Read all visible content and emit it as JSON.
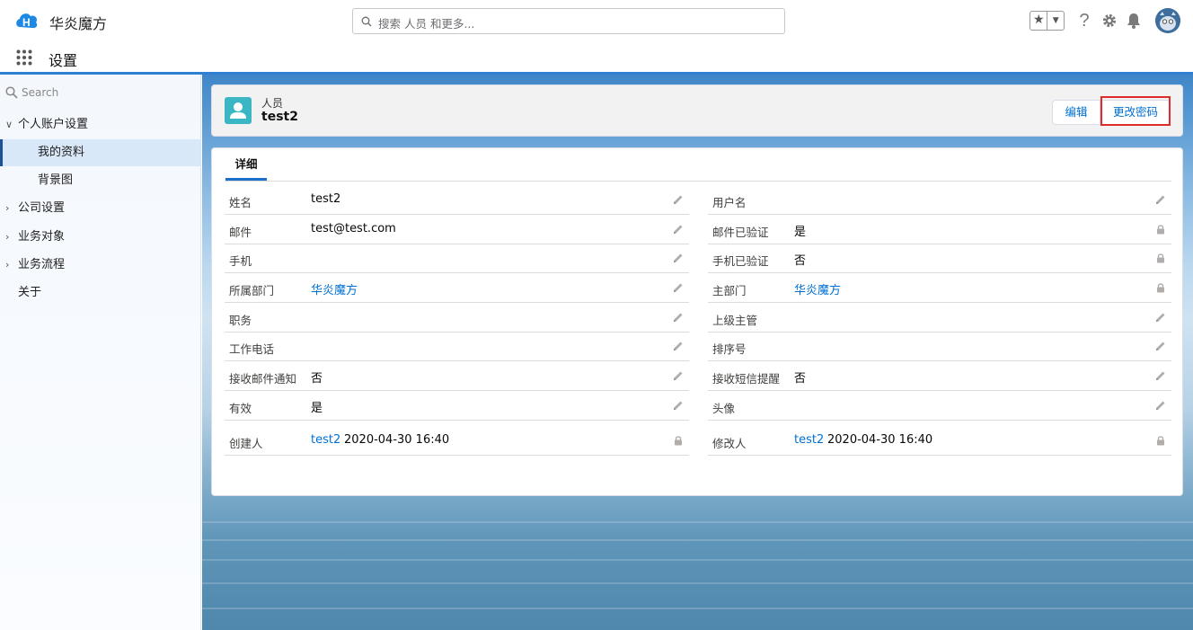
{
  "header": {
    "brand": "华炎魔方",
    "search_placeholder": "搜索 人员 和更多..."
  },
  "appbar": {
    "title": "设置"
  },
  "sidebar": {
    "search_placeholder": "Search",
    "items": [
      {
        "label": "个人账户设置",
        "chevron": "v"
      },
      {
        "label": "我的资料"
      },
      {
        "label": "背景图"
      },
      {
        "label": "公司设置",
        "chevron": ">"
      },
      {
        "label": "业务对象",
        "chevron": ">"
      },
      {
        "label": "业务流程",
        "chevron": ">"
      },
      {
        "label": "关于"
      }
    ]
  },
  "record": {
    "type": "人员",
    "name": "test2",
    "edit_label": "编辑",
    "change_password_label": "更改密码"
  },
  "detail": {
    "tab_label": "详细",
    "left": [
      {
        "label": "姓名",
        "value": "test2",
        "action": "pencil"
      },
      {
        "label": "邮件",
        "value": "test@test.com",
        "action": "pencil"
      },
      {
        "label": "手机",
        "value": "",
        "action": "pencil"
      },
      {
        "label": "所属部门",
        "value": "华炎魔方",
        "link": true,
        "action": "pencil"
      },
      {
        "label": "职务",
        "value": "",
        "action": "pencil"
      },
      {
        "label": "工作电话",
        "value": "",
        "action": "pencil"
      },
      {
        "label": "接收邮件通知",
        "value": "否",
        "action": "pencil"
      },
      {
        "label": "有效",
        "value": "是",
        "action": "pencil"
      },
      {
        "label": "创建人",
        "value": "test2",
        "date": "2020-04-30 16:40",
        "link": true,
        "action": "lock"
      }
    ],
    "right": [
      {
        "label": "用户名",
        "value": "",
        "action": "pencil"
      },
      {
        "label": "邮件已验证",
        "value": "是",
        "action": "lock"
      },
      {
        "label": "手机已验证",
        "value": "否",
        "action": "lock"
      },
      {
        "label": "主部门",
        "value": "华炎魔方",
        "link": true,
        "action": "lock"
      },
      {
        "label": "上级主管",
        "value": "",
        "action": "pencil"
      },
      {
        "label": "排序号",
        "value": "",
        "action": "pencil"
      },
      {
        "label": "接收短信提醒",
        "value": "否",
        "action": "pencil"
      },
      {
        "label": "头像",
        "value": "",
        "action": "pencil"
      },
      {
        "label": "修改人",
        "value": "test2",
        "date": "2020-04-30 16:40",
        "link": true,
        "action": "lock"
      }
    ]
  },
  "colors": {
    "accent": "#0070d2",
    "highlight": "#e02b2b",
    "record_icon": "#3ab6c4"
  }
}
